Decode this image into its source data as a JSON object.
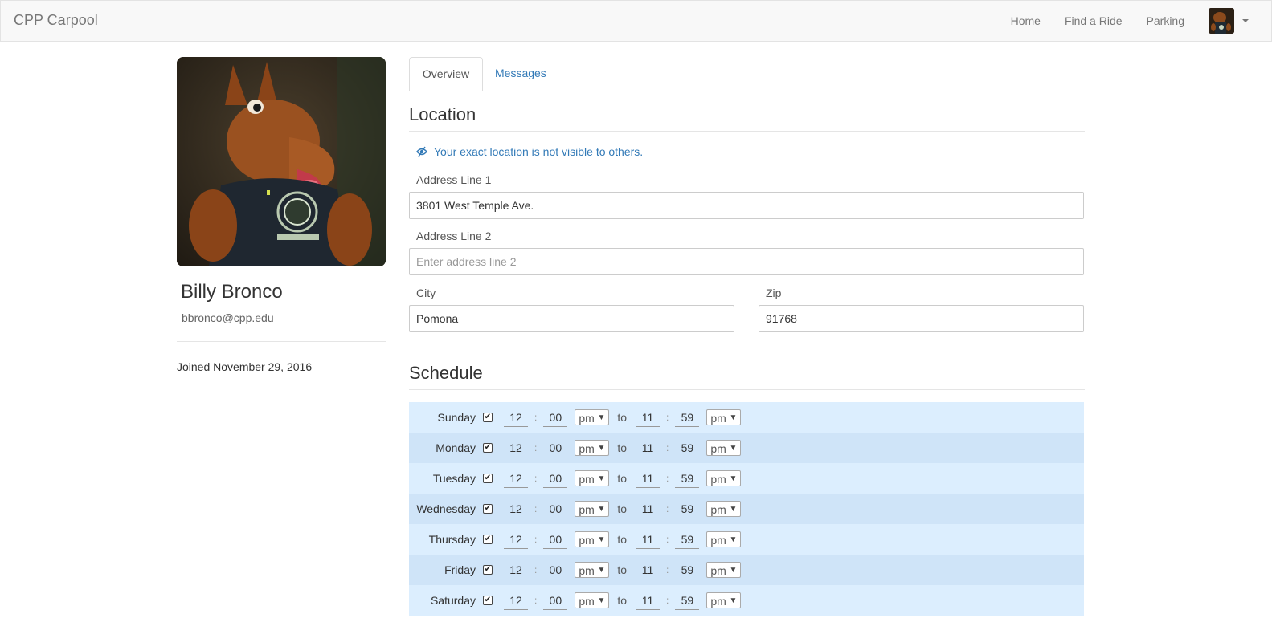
{
  "nav": {
    "brand": "CPP Carpool",
    "links": [
      "Home",
      "Find a Ride",
      "Parking"
    ]
  },
  "profile": {
    "name": "Billy Bronco",
    "email": "bbronco@cpp.edu",
    "joined": "Joined November 29, 2016"
  },
  "tabs": [
    "Overview",
    "Messages"
  ],
  "location": {
    "title": "Location",
    "notice": "Your exact location is not visible to others.",
    "address1_label": "Address Line 1",
    "address1_value": "3801 West Temple Ave.",
    "address2_label": "Address Line 2",
    "address2_placeholder": "Enter address line 2",
    "city_label": "City",
    "city_value": "Pomona",
    "zip_label": "Zip",
    "zip_value": "91768"
  },
  "schedule": {
    "title": "Schedule",
    "to_label": "to",
    "days": [
      {
        "day": "Sunday",
        "start_h": "12",
        "start_m": "00",
        "start_ampm": "pm",
        "end_h": "11",
        "end_m": "59",
        "end_ampm": "pm"
      },
      {
        "day": "Monday",
        "start_h": "12",
        "start_m": "00",
        "start_ampm": "pm",
        "end_h": "11",
        "end_m": "59",
        "end_ampm": "pm"
      },
      {
        "day": "Tuesday",
        "start_h": "12",
        "start_m": "00",
        "start_ampm": "pm",
        "end_h": "11",
        "end_m": "59",
        "end_ampm": "pm"
      },
      {
        "day": "Wednesday",
        "start_h": "12",
        "start_m": "00",
        "start_ampm": "pm",
        "end_h": "11",
        "end_m": "59",
        "end_ampm": "pm"
      },
      {
        "day": "Thursday",
        "start_h": "12",
        "start_m": "00",
        "start_ampm": "pm",
        "end_h": "11",
        "end_m": "59",
        "end_ampm": "pm"
      },
      {
        "day": "Friday",
        "start_h": "12",
        "start_m": "00",
        "start_ampm": "pm",
        "end_h": "11",
        "end_m": "59",
        "end_ampm": "pm"
      },
      {
        "day": "Saturday",
        "start_h": "12",
        "start_m": "00",
        "start_ampm": "pm",
        "end_h": "11",
        "end_m": "59",
        "end_ampm": "pm"
      }
    ]
  },
  "colors": {
    "link": "#337ab7",
    "row_light": "#dceefe",
    "row_dark": "#cfe4f8"
  }
}
